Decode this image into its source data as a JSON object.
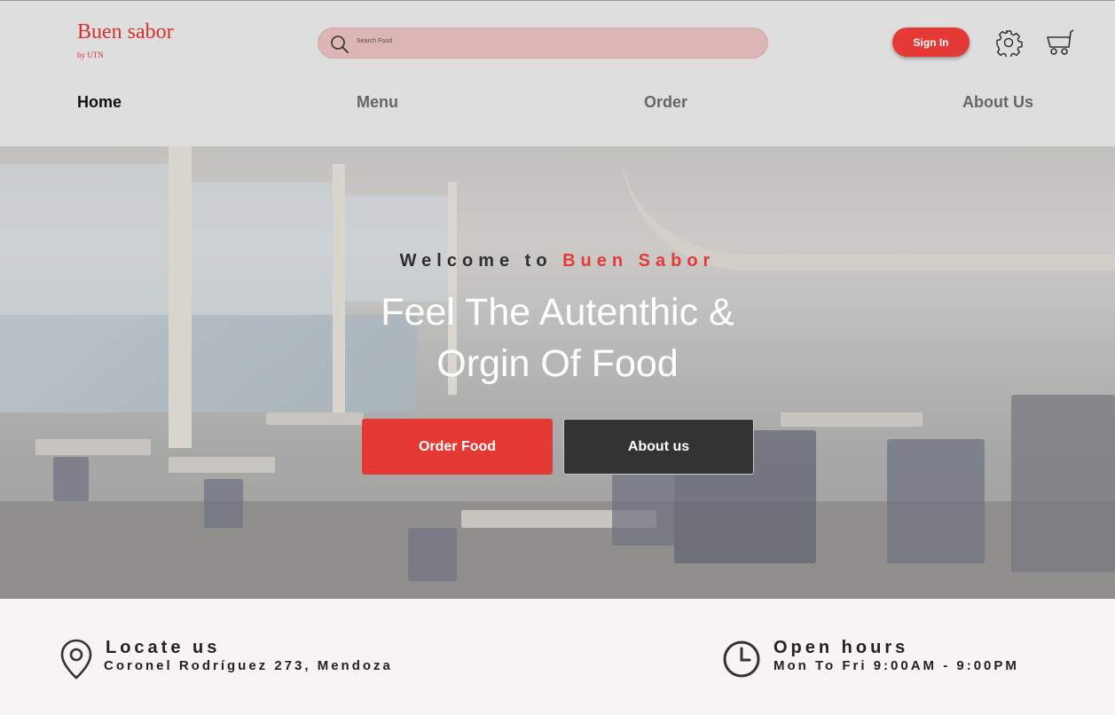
{
  "brand": {
    "name": "Buen sabor",
    "sub": "by UTN"
  },
  "search": {
    "placeholder": "Search Food"
  },
  "header": {
    "signin_label": "Sign In"
  },
  "nav": [
    {
      "label": "Home",
      "active": true
    },
    {
      "label": "Menu",
      "active": false
    },
    {
      "label": "Order",
      "active": false
    },
    {
      "label": "About Us",
      "active": false
    }
  ],
  "hero": {
    "welcome_prefix": "Welcome to",
    "welcome_brand": "Buen Sabor",
    "headline_line1": "Feel The Autenthic &",
    "headline_line2": "Orgin Of Food",
    "order_button": "Order Food",
    "about_button": "About us"
  },
  "info": {
    "locate_title": "Locate us",
    "locate_text": "Coronel Rodríguez 273, Mendoza",
    "hours_title": "Open hours",
    "hours_text": "Mon To Fri 9:00AM - 9:00PM"
  },
  "colors": {
    "accent": "#e53935",
    "dark_button": "#333333",
    "search_bg": "#dcb5b5",
    "header_bg": "#dedede"
  },
  "icons": [
    "search-icon",
    "gear-icon",
    "cart-icon",
    "location-pin-icon",
    "clock-icon"
  ]
}
